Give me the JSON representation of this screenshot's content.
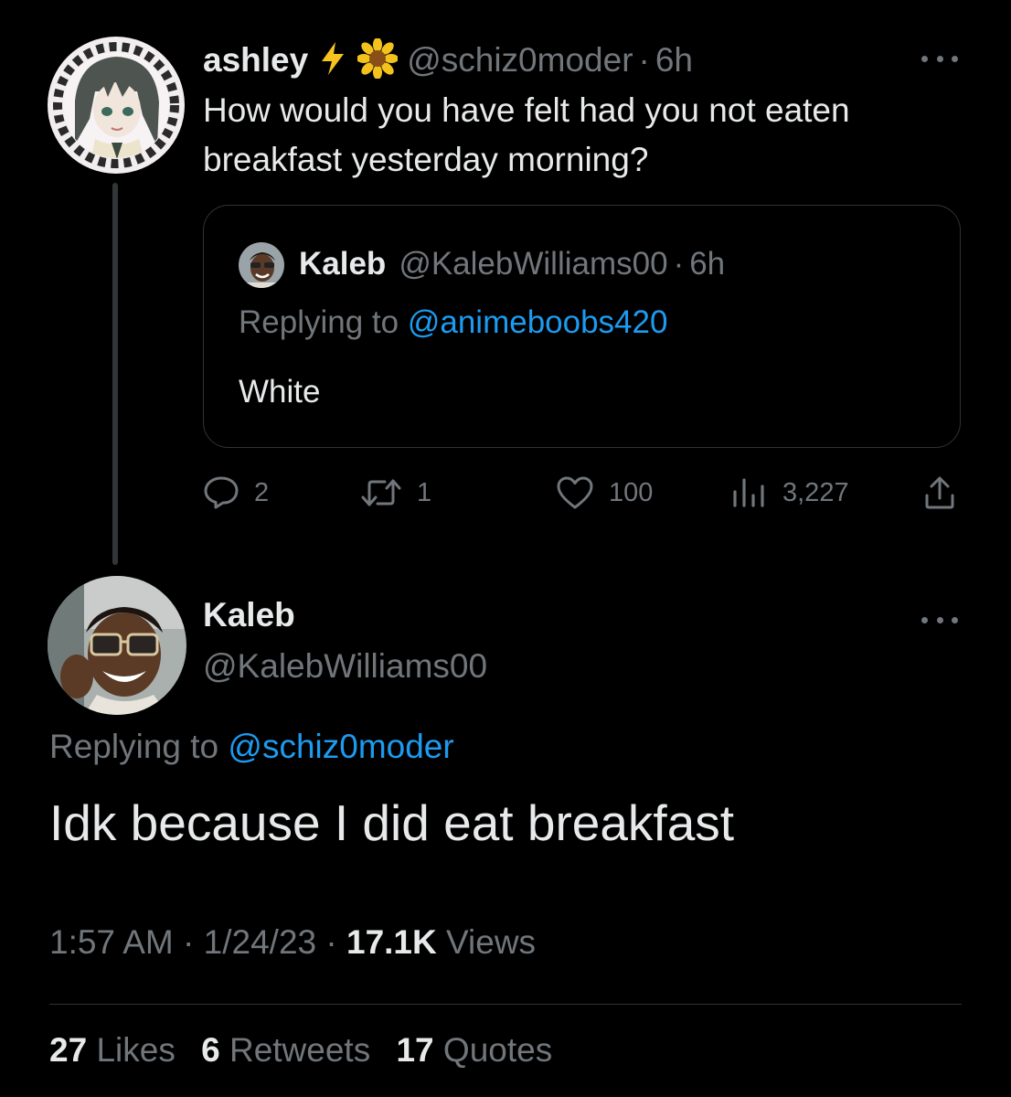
{
  "parent_tweet": {
    "display_name": "ashley",
    "badges": [
      "lightning-emoji",
      "sunflower-emoji"
    ],
    "handle": "@schiz0moder",
    "sep": "·",
    "time": "6h",
    "text": "How would you have felt had you not eaten breakfast yesterday morning?",
    "quoted_tweet": {
      "display_name": "Kaleb",
      "handle": "@KalebWilliams00",
      "sep": "·",
      "time": "6h",
      "replying_prefix": "Replying to",
      "replying_to": "@animeboobs420",
      "text": "White"
    },
    "actions": {
      "replies": "2",
      "retweets": "1",
      "likes": "100",
      "views": "3,227"
    }
  },
  "main_tweet": {
    "display_name": "Kaleb",
    "handle": "@KalebWilliams00",
    "replying_prefix": "Replying to",
    "replying_to": "@schiz0moder",
    "text": "Idk because I did eat breakfast",
    "time": "1:57 AM",
    "date": "1/24/23",
    "sep": "·",
    "views_count": "17.1K",
    "views_label": "Views",
    "likes_count": "27",
    "likes_label": "Likes",
    "retweets_count": "6",
    "retweets_label": "Retweets",
    "quotes_count": "17",
    "quotes_label": "Quotes"
  },
  "colors": {
    "background": "#000000",
    "primary_text": "#e7e9ea",
    "secondary_text": "#71767b",
    "link": "#1d9bf0",
    "border": "#2f3336"
  }
}
